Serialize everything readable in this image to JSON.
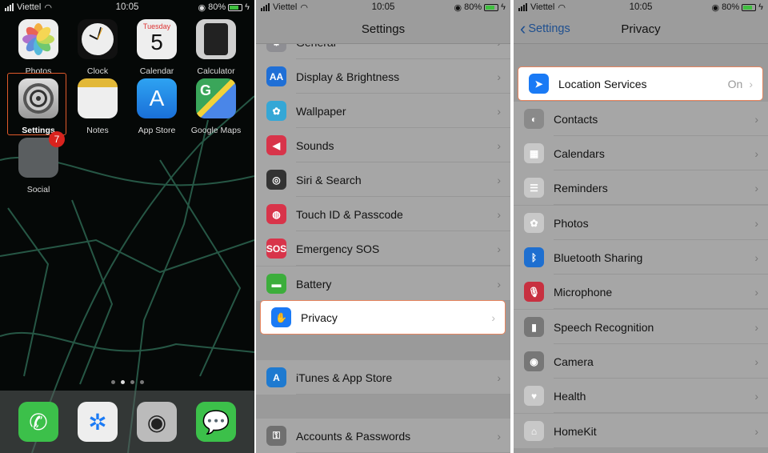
{
  "status_bar": {
    "carrier": "Viettel",
    "time": "10:05",
    "battery": "80%",
    "battery_level": 0.8
  },
  "home": {
    "apps": [
      {
        "label": "Photos",
        "icon": "photos-icon"
      },
      {
        "label": "Clock",
        "icon": "clock-icon"
      },
      {
        "label": "Calendar",
        "icon": "calendar-icon",
        "day": "Tuesday",
        "date": "5"
      },
      {
        "label": "Calculator",
        "icon": "calculator-icon"
      },
      {
        "label": "Settings",
        "icon": "settings-gear-icon"
      },
      {
        "label": "Notes",
        "icon": "notes-icon"
      },
      {
        "label": "App Store",
        "icon": "app-store-icon"
      },
      {
        "label": "Google Maps",
        "icon": "google-maps-icon"
      },
      {
        "label": "Social",
        "icon": "folder-icon",
        "badge": "7"
      }
    ],
    "dock": [
      "phone-icon",
      "safari-icon",
      "camera-icon",
      "messages-icon"
    ],
    "highlight_color": "#e05a2a"
  },
  "settings": {
    "title": "Settings",
    "rows": [
      {
        "label": "General",
        "color": "#8e8e93"
      },
      {
        "label": "Display & Brightness",
        "color": "#1f6fd6"
      },
      {
        "label": "Wallpaper",
        "color": "#35a7d6"
      },
      {
        "label": "Sounds",
        "color": "#d8344a"
      },
      {
        "label": "Siri & Search",
        "color": "#333"
      },
      {
        "label": "Touch ID & Passcode",
        "color": "#d8344a"
      },
      {
        "label": "Emergency SOS",
        "color": "#d8344a"
      },
      {
        "label": "Battery",
        "color": "#3cae3c"
      },
      {
        "label": "Privacy",
        "color": "#1a7af5"
      },
      {
        "label": "iTunes & App Store",
        "color": "#1e7ad0"
      },
      {
        "label": "Accounts & Passwords",
        "color": "#707070"
      }
    ]
  },
  "privacy": {
    "back": "Settings",
    "title": "Privacy",
    "rows": [
      {
        "label": "Location Services",
        "value": "On",
        "color": "#1a7af5"
      },
      {
        "label": "Contacts",
        "color": "#8a8a8a"
      },
      {
        "label": "Calendars",
        "color": "#c8c8c8"
      },
      {
        "label": "Reminders",
        "color": "#c8c8c8"
      },
      {
        "label": "Photos",
        "color": "#c8c8c8"
      },
      {
        "label": "Bluetooth Sharing",
        "color": "#1e6fd0"
      },
      {
        "label": "Microphone",
        "color": "#c83040"
      },
      {
        "label": "Speech Recognition",
        "color": "#777"
      },
      {
        "label": "Camera",
        "color": "#777"
      },
      {
        "label": "Health",
        "color": "#c8c8c8"
      },
      {
        "label": "HomeKit",
        "color": "#c8c8c8"
      }
    ]
  }
}
